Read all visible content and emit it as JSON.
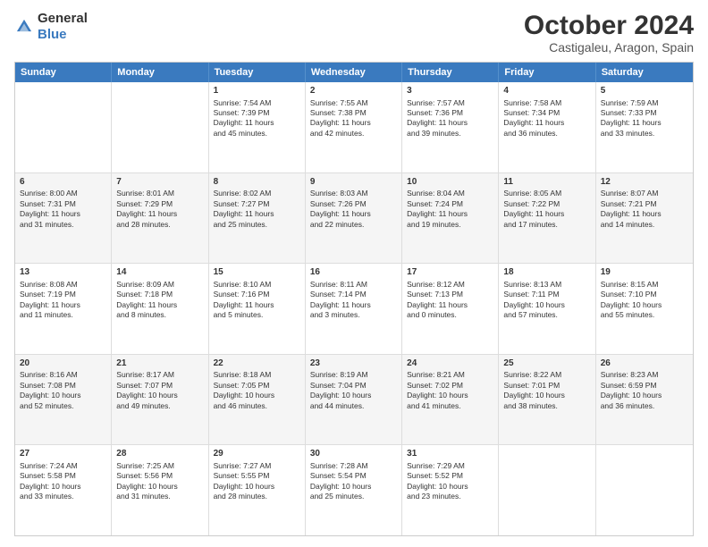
{
  "logo": {
    "general": "General",
    "blue": "Blue"
  },
  "title": "October 2024",
  "subtitle": "Castigaleu, Aragon, Spain",
  "header_days": [
    "Sunday",
    "Monday",
    "Tuesday",
    "Wednesday",
    "Thursday",
    "Friday",
    "Saturday"
  ],
  "rows": [
    {
      "alt": false,
      "cells": [
        {
          "day": "",
          "lines": []
        },
        {
          "day": "",
          "lines": []
        },
        {
          "day": "1",
          "lines": [
            "Sunrise: 7:54 AM",
            "Sunset: 7:39 PM",
            "Daylight: 11 hours",
            "and 45 minutes."
          ]
        },
        {
          "day": "2",
          "lines": [
            "Sunrise: 7:55 AM",
            "Sunset: 7:38 PM",
            "Daylight: 11 hours",
            "and 42 minutes."
          ]
        },
        {
          "day": "3",
          "lines": [
            "Sunrise: 7:57 AM",
            "Sunset: 7:36 PM",
            "Daylight: 11 hours",
            "and 39 minutes."
          ]
        },
        {
          "day": "4",
          "lines": [
            "Sunrise: 7:58 AM",
            "Sunset: 7:34 PM",
            "Daylight: 11 hours",
            "and 36 minutes."
          ]
        },
        {
          "day": "5",
          "lines": [
            "Sunrise: 7:59 AM",
            "Sunset: 7:33 PM",
            "Daylight: 11 hours",
            "and 33 minutes."
          ]
        }
      ]
    },
    {
      "alt": true,
      "cells": [
        {
          "day": "6",
          "lines": [
            "Sunrise: 8:00 AM",
            "Sunset: 7:31 PM",
            "Daylight: 11 hours",
            "and 31 minutes."
          ]
        },
        {
          "day": "7",
          "lines": [
            "Sunrise: 8:01 AM",
            "Sunset: 7:29 PM",
            "Daylight: 11 hours",
            "and 28 minutes."
          ]
        },
        {
          "day": "8",
          "lines": [
            "Sunrise: 8:02 AM",
            "Sunset: 7:27 PM",
            "Daylight: 11 hours",
            "and 25 minutes."
          ]
        },
        {
          "day": "9",
          "lines": [
            "Sunrise: 8:03 AM",
            "Sunset: 7:26 PM",
            "Daylight: 11 hours",
            "and 22 minutes."
          ]
        },
        {
          "day": "10",
          "lines": [
            "Sunrise: 8:04 AM",
            "Sunset: 7:24 PM",
            "Daylight: 11 hours",
            "and 19 minutes."
          ]
        },
        {
          "day": "11",
          "lines": [
            "Sunrise: 8:05 AM",
            "Sunset: 7:22 PM",
            "Daylight: 11 hours",
            "and 17 minutes."
          ]
        },
        {
          "day": "12",
          "lines": [
            "Sunrise: 8:07 AM",
            "Sunset: 7:21 PM",
            "Daylight: 11 hours",
            "and 14 minutes."
          ]
        }
      ]
    },
    {
      "alt": false,
      "cells": [
        {
          "day": "13",
          "lines": [
            "Sunrise: 8:08 AM",
            "Sunset: 7:19 PM",
            "Daylight: 11 hours",
            "and 11 minutes."
          ]
        },
        {
          "day": "14",
          "lines": [
            "Sunrise: 8:09 AM",
            "Sunset: 7:18 PM",
            "Daylight: 11 hours",
            "and 8 minutes."
          ]
        },
        {
          "day": "15",
          "lines": [
            "Sunrise: 8:10 AM",
            "Sunset: 7:16 PM",
            "Daylight: 11 hours",
            "and 5 minutes."
          ]
        },
        {
          "day": "16",
          "lines": [
            "Sunrise: 8:11 AM",
            "Sunset: 7:14 PM",
            "Daylight: 11 hours",
            "and 3 minutes."
          ]
        },
        {
          "day": "17",
          "lines": [
            "Sunrise: 8:12 AM",
            "Sunset: 7:13 PM",
            "Daylight: 11 hours",
            "and 0 minutes."
          ]
        },
        {
          "day": "18",
          "lines": [
            "Sunrise: 8:13 AM",
            "Sunset: 7:11 PM",
            "Daylight: 10 hours",
            "and 57 minutes."
          ]
        },
        {
          "day": "19",
          "lines": [
            "Sunrise: 8:15 AM",
            "Sunset: 7:10 PM",
            "Daylight: 10 hours",
            "and 55 minutes."
          ]
        }
      ]
    },
    {
      "alt": true,
      "cells": [
        {
          "day": "20",
          "lines": [
            "Sunrise: 8:16 AM",
            "Sunset: 7:08 PM",
            "Daylight: 10 hours",
            "and 52 minutes."
          ]
        },
        {
          "day": "21",
          "lines": [
            "Sunrise: 8:17 AM",
            "Sunset: 7:07 PM",
            "Daylight: 10 hours",
            "and 49 minutes."
          ]
        },
        {
          "day": "22",
          "lines": [
            "Sunrise: 8:18 AM",
            "Sunset: 7:05 PM",
            "Daylight: 10 hours",
            "and 46 minutes."
          ]
        },
        {
          "day": "23",
          "lines": [
            "Sunrise: 8:19 AM",
            "Sunset: 7:04 PM",
            "Daylight: 10 hours",
            "and 44 minutes."
          ]
        },
        {
          "day": "24",
          "lines": [
            "Sunrise: 8:21 AM",
            "Sunset: 7:02 PM",
            "Daylight: 10 hours",
            "and 41 minutes."
          ]
        },
        {
          "day": "25",
          "lines": [
            "Sunrise: 8:22 AM",
            "Sunset: 7:01 PM",
            "Daylight: 10 hours",
            "and 38 minutes."
          ]
        },
        {
          "day": "26",
          "lines": [
            "Sunrise: 8:23 AM",
            "Sunset: 6:59 PM",
            "Daylight: 10 hours",
            "and 36 minutes."
          ]
        }
      ]
    },
    {
      "alt": false,
      "cells": [
        {
          "day": "27",
          "lines": [
            "Sunrise: 7:24 AM",
            "Sunset: 5:58 PM",
            "Daylight: 10 hours",
            "and 33 minutes."
          ]
        },
        {
          "day": "28",
          "lines": [
            "Sunrise: 7:25 AM",
            "Sunset: 5:56 PM",
            "Daylight: 10 hours",
            "and 31 minutes."
          ]
        },
        {
          "day": "29",
          "lines": [
            "Sunrise: 7:27 AM",
            "Sunset: 5:55 PM",
            "Daylight: 10 hours",
            "and 28 minutes."
          ]
        },
        {
          "day": "30",
          "lines": [
            "Sunrise: 7:28 AM",
            "Sunset: 5:54 PM",
            "Daylight: 10 hours",
            "and 25 minutes."
          ]
        },
        {
          "day": "31",
          "lines": [
            "Sunrise: 7:29 AM",
            "Sunset: 5:52 PM",
            "Daylight: 10 hours",
            "and 23 minutes."
          ]
        },
        {
          "day": "",
          "lines": []
        },
        {
          "day": "",
          "lines": []
        }
      ]
    }
  ]
}
